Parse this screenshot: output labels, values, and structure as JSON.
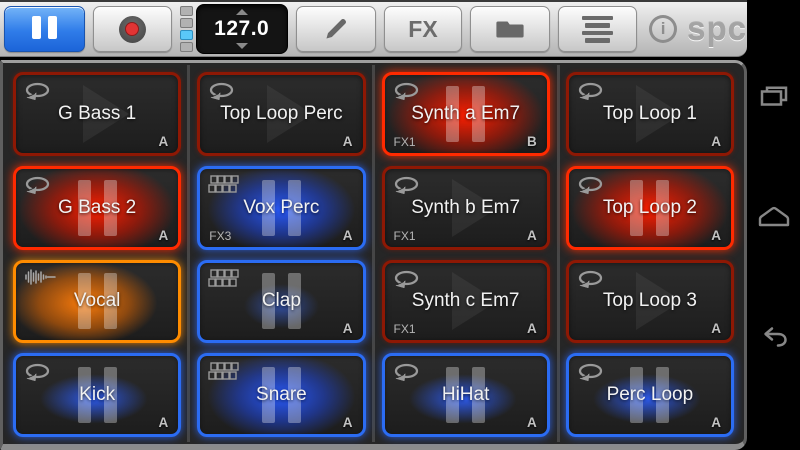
{
  "toolbar": {
    "play_pause": {
      "icon": "pause-icon",
      "active": true
    },
    "record": {
      "icon": "record-icon"
    },
    "beat_indicator": {
      "segments": [
        "off",
        "off",
        "on",
        "off"
      ],
      "active_color": "#5ac8f8"
    },
    "tempo": {
      "value": "127.0"
    },
    "edit": {
      "icon": "pencil-icon"
    },
    "fx_label": "FX",
    "folder": {
      "icon": "folder-icon"
    },
    "list": {
      "icon": "list-icon"
    },
    "info": {
      "glyph": "i"
    },
    "logo": "spc"
  },
  "colors": {
    "red_dim": "#8e1804",
    "red_bright": "#ff2a00",
    "blue": "#2b6cf3",
    "orange": "#ff8c00",
    "toolbar_blue": "#2f7ce9"
  },
  "pads": [
    {
      "label": "G Bass 1",
      "bank": "A",
      "fx": "",
      "icon": "loop",
      "border": "red-dim",
      "glow": "none",
      "playing": false
    },
    {
      "label": "Top Loop Perc",
      "bank": "A",
      "fx": "",
      "icon": "loop",
      "border": "red-dim",
      "glow": "none",
      "playing": false
    },
    {
      "label": "Synth a Em7",
      "bank": "B",
      "fx": "FX1",
      "icon": "loop",
      "border": "red-bright",
      "glow": "red",
      "playing": true
    },
    {
      "label": "Top Loop 1",
      "bank": "A",
      "fx": "",
      "icon": "loop",
      "border": "red-dim",
      "glow": "none",
      "playing": false
    },
    {
      "label": "G Bass 2",
      "bank": "A",
      "fx": "",
      "icon": "loop",
      "border": "red-bright",
      "glow": "red",
      "playing": true
    },
    {
      "label": "Vox Perc",
      "bank": "A",
      "fx": "FX3",
      "icon": "slices",
      "border": "blue",
      "glow": "blue",
      "playing": true
    },
    {
      "label": "Synth b Em7",
      "bank": "A",
      "fx": "FX1",
      "icon": "loop",
      "border": "red-dim",
      "glow": "none",
      "playing": false
    },
    {
      "label": "Top Loop 2",
      "bank": "A",
      "fx": "",
      "icon": "loop",
      "border": "red-bright",
      "glow": "red",
      "playing": true
    },
    {
      "label": "Vocal",
      "bank": "",
      "fx": "",
      "icon": "waveform",
      "border": "orange",
      "glow": "orange",
      "playing": true
    },
    {
      "label": "Clap",
      "bank": "A",
      "fx": "",
      "icon": "slices",
      "border": "blue",
      "glow": "blue-soft",
      "playing": true
    },
    {
      "label": "Synth c Em7",
      "bank": "A",
      "fx": "FX1",
      "icon": "loop",
      "border": "red-dim",
      "glow": "none",
      "playing": false
    },
    {
      "label": "Top Loop 3",
      "bank": "A",
      "fx": "",
      "icon": "loop",
      "border": "red-dim",
      "glow": "none",
      "playing": false
    },
    {
      "label": "Kick",
      "bank": "A",
      "fx": "",
      "icon": "loop",
      "border": "blue",
      "glow": "blue-band",
      "playing": true
    },
    {
      "label": "Snare",
      "bank": "A",
      "fx": "",
      "icon": "slices",
      "border": "blue",
      "glow": "blue",
      "playing": true
    },
    {
      "label": "HiHat",
      "bank": "A",
      "fx": "",
      "icon": "loop",
      "border": "blue",
      "glow": "blue-band",
      "playing": true
    },
    {
      "label": "Perc Loop",
      "bank": "A",
      "fx": "",
      "icon": "loop",
      "border": "blue",
      "glow": "blue-band",
      "playing": true
    }
  ],
  "nav": {
    "items": [
      {
        "name": "recents"
      },
      {
        "name": "home"
      },
      {
        "name": "back"
      }
    ]
  }
}
